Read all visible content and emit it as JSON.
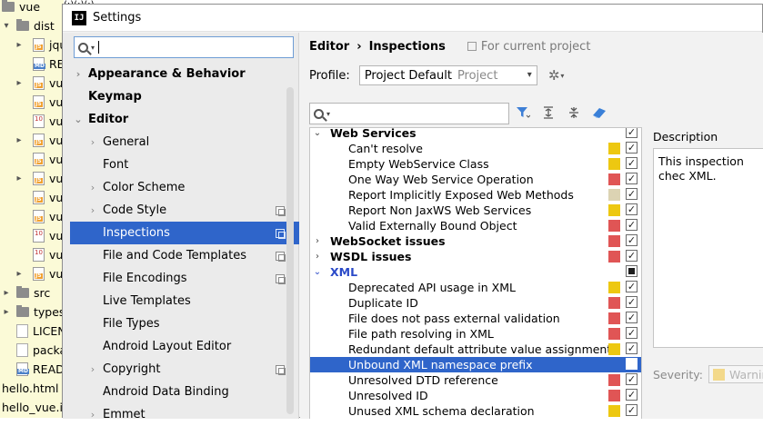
{
  "colors": {
    "selection": "#2f65ca",
    "warning": "#edc811",
    "error": "#e05555",
    "weak_warning": "#dcd3b3",
    "xml_blue": "#2b4ac8"
  },
  "background_project": {
    "top_fragment": "(:)(:)(:)",
    "rows": [
      {
        "label": "vue",
        "icon": "folder-icon",
        "depth": 0,
        "arrow": ""
      },
      {
        "label": "dist",
        "icon": "folder-icon",
        "depth": 1,
        "arrow": "▾"
      },
      {
        "label": "jqu",
        "icon": "js-file-icon",
        "depth": 2,
        "arrow": "▸"
      },
      {
        "label": "RE",
        "icon": "markdown-file-icon",
        "depth": 2,
        "arrow": ""
      },
      {
        "label": "vu",
        "icon": "js-file-icon",
        "depth": 2,
        "arrow": "▸"
      },
      {
        "label": "vu",
        "icon": "js-file-icon",
        "depth": 2,
        "arrow": ""
      },
      {
        "label": "vu",
        "icon": "binary-file-icon",
        "depth": 2,
        "arrow": ""
      },
      {
        "label": "vu",
        "icon": "js-file-icon",
        "depth": 2,
        "arrow": "▸"
      },
      {
        "label": "vu",
        "icon": "js-file-icon",
        "depth": 2,
        "arrow": ""
      },
      {
        "label": "vu",
        "icon": "js-file-icon",
        "depth": 2,
        "arrow": "▸"
      },
      {
        "label": "vu",
        "icon": "js-file-icon",
        "depth": 2,
        "arrow": ""
      },
      {
        "label": "vu",
        "icon": "js-file-icon",
        "depth": 2,
        "arrow": ""
      },
      {
        "label": "vu",
        "icon": "binary-file-icon",
        "depth": 2,
        "arrow": ""
      },
      {
        "label": "vu",
        "icon": "binary-file-icon",
        "depth": 2,
        "arrow": ""
      },
      {
        "label": "vu",
        "icon": "js-file-icon",
        "depth": 2,
        "arrow": "▸"
      },
      {
        "label": "src",
        "icon": "folder-icon",
        "depth": 1,
        "arrow": "▸"
      },
      {
        "label": "types",
        "icon": "folder-icon",
        "depth": 1,
        "arrow": "▸"
      },
      {
        "label": "LICEN",
        "icon": "text-file-icon",
        "depth": 1,
        "arrow": ""
      },
      {
        "label": "packa",
        "icon": "text-file-icon",
        "depth": 1,
        "arrow": ""
      },
      {
        "label": "READ",
        "icon": "markdown-file-icon",
        "depth": 1,
        "arrow": ""
      },
      {
        "label": "hello.html",
        "icon": "",
        "depth": 0,
        "arrow": ""
      },
      {
        "label": "hello_vue.iml",
        "icon": "",
        "depth": 0,
        "arrow": ""
      }
    ]
  },
  "dialog": {
    "title": "Settings",
    "search": {
      "value": "",
      "placeholder": ""
    },
    "tree": [
      {
        "label": "Appearance & Behavior",
        "bold": true,
        "arrow": "›",
        "depth": 0,
        "copy": false,
        "selected": false
      },
      {
        "label": "Keymap",
        "bold": true,
        "arrow": "",
        "depth": 0,
        "copy": false,
        "selected": false
      },
      {
        "label": "Editor",
        "bold": true,
        "arrow": "⌄",
        "depth": 0,
        "copy": false,
        "selected": false
      },
      {
        "label": "General",
        "bold": false,
        "arrow": "›",
        "depth": 1,
        "copy": false,
        "selected": false
      },
      {
        "label": "Font",
        "bold": false,
        "arrow": "",
        "depth": 1,
        "copy": false,
        "selected": false
      },
      {
        "label": "Color Scheme",
        "bold": false,
        "arrow": "›",
        "depth": 1,
        "copy": false,
        "selected": false
      },
      {
        "label": "Code Style",
        "bold": false,
        "arrow": "›",
        "depth": 1,
        "copy": true,
        "selected": false
      },
      {
        "label": "Inspections",
        "bold": false,
        "arrow": "",
        "depth": 1,
        "copy": true,
        "selected": true
      },
      {
        "label": "File and Code Templates",
        "bold": false,
        "arrow": "",
        "depth": 1,
        "copy": true,
        "selected": false
      },
      {
        "label": "File Encodings",
        "bold": false,
        "arrow": "",
        "depth": 1,
        "copy": true,
        "selected": false
      },
      {
        "label": "Live Templates",
        "bold": false,
        "arrow": "",
        "depth": 1,
        "copy": false,
        "selected": false
      },
      {
        "label": "File Types",
        "bold": false,
        "arrow": "",
        "depth": 1,
        "copy": false,
        "selected": false
      },
      {
        "label": "Android Layout Editor",
        "bold": false,
        "arrow": "",
        "depth": 1,
        "copy": false,
        "selected": false
      },
      {
        "label": "Copyright",
        "bold": false,
        "arrow": "›",
        "depth": 1,
        "copy": true,
        "selected": false
      },
      {
        "label": "Android Data Binding",
        "bold": false,
        "arrow": "",
        "depth": 1,
        "copy": false,
        "selected": false
      },
      {
        "label": "Emmet",
        "bold": false,
        "arrow": "›",
        "depth": 1,
        "copy": false,
        "selected": false
      }
    ],
    "breadcrumb": {
      "section": "Editor",
      "separator": "›",
      "page": "Inspections",
      "scope": "For current project"
    },
    "profile": {
      "label": "Profile:",
      "name": "Project Default",
      "kind": "Project"
    },
    "inspection_search": {
      "value": "",
      "placeholder": ""
    },
    "inspections": [
      {
        "label": "Web Services",
        "category": true,
        "expanded": true,
        "severity": "",
        "check": "checked",
        "selected": false,
        "blue": false
      },
      {
        "label": "Can't resolve",
        "category": false,
        "severity": "warning",
        "check": "checked",
        "selected": false
      },
      {
        "label": "Empty WebService Class",
        "category": false,
        "severity": "warning",
        "check": "checked",
        "selected": false
      },
      {
        "label": "One Way Web Service Operation",
        "category": false,
        "severity": "error",
        "check": "checked",
        "selected": false
      },
      {
        "label": "Report Implicitly Exposed Web Methods",
        "category": false,
        "severity": "weak_warning",
        "check": "checked",
        "selected": false
      },
      {
        "label": "Report Non JaxWS Web Services",
        "category": false,
        "severity": "warning",
        "check": "checked",
        "selected": false
      },
      {
        "label": "Valid Externally Bound Object",
        "category": false,
        "severity": "error",
        "check": "checked",
        "selected": false
      },
      {
        "label": "WebSocket issues",
        "category": true,
        "expanded": false,
        "severity": "error",
        "check": "checked",
        "selected": false,
        "blue": false
      },
      {
        "label": "WSDL issues",
        "category": true,
        "expanded": false,
        "severity": "error",
        "check": "checked",
        "selected": false,
        "blue": false
      },
      {
        "label": "XML",
        "category": true,
        "expanded": true,
        "severity": "",
        "check": "mixed",
        "selected": false,
        "blue": true
      },
      {
        "label": "Deprecated API usage in XML",
        "category": false,
        "severity": "warning",
        "check": "checked",
        "selected": false
      },
      {
        "label": "Duplicate ID",
        "category": false,
        "severity": "error",
        "check": "checked",
        "selected": false
      },
      {
        "label": "File does not pass external validation",
        "category": false,
        "severity": "error",
        "check": "checked",
        "selected": false
      },
      {
        "label": "File path resolving in XML",
        "category": false,
        "severity": "error",
        "check": "checked",
        "selected": false
      },
      {
        "label": "Redundant default attribute value assignment",
        "category": false,
        "severity": "warning",
        "check": "checked",
        "selected": false
      },
      {
        "label": "Unbound XML namespace prefix",
        "category": false,
        "severity": "",
        "check": "unchecked",
        "selected": true
      },
      {
        "label": "Unresolved DTD reference",
        "category": false,
        "severity": "error",
        "check": "checked",
        "selected": false
      },
      {
        "label": "Unresolved ID",
        "category": false,
        "severity": "error",
        "check": "checked",
        "selected": false
      },
      {
        "label": "Unused XML schema declaration",
        "category": false,
        "severity": "warning",
        "check": "checked",
        "selected": false
      }
    ],
    "description": {
      "label": "Description",
      "text": "This inspection chec XML."
    },
    "severity": {
      "label": "Severity:",
      "value": "Warning"
    }
  }
}
